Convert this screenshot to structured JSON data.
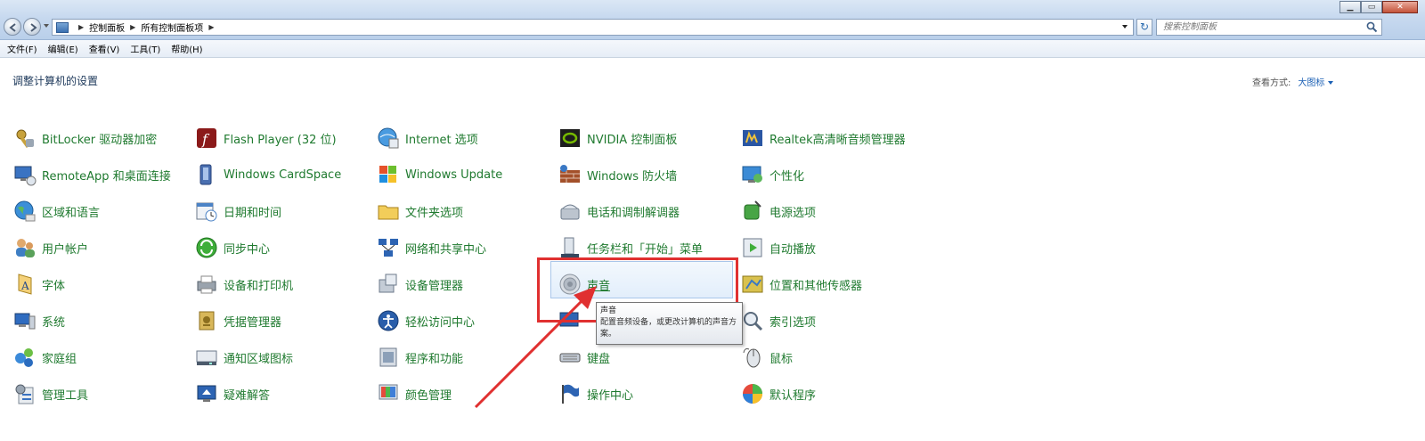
{
  "breadcrumb": [
    "控制面板",
    "所有控制面板项"
  ],
  "search": {
    "placeholder": "搜索控制面板"
  },
  "menu": [
    "文件(F)",
    "编辑(E)",
    "查看(V)",
    "工具(T)",
    "帮助(H)"
  ],
  "page_title": "调整计算机的设置",
  "view_by": {
    "label": "查看方式:",
    "value": "大图标"
  },
  "items": [
    "BitLocker 驱动器加密",
    "Flash Player (32 位)",
    "Internet 选项",
    "NVIDIA 控制面板",
    "Realtek高清晰音频管理器",
    "RemoteApp 和桌面连接",
    "Windows CardSpace",
    "Windows Update",
    "Windows 防火墙",
    "个性化",
    "区域和语言",
    "日期和时间",
    "文件夹选项",
    "电话和调制解调器",
    "电源选项",
    "用户帐户",
    "同步中心",
    "网络和共享中心",
    "任务栏和「开始」菜单",
    "自动播放",
    "字体",
    "设备和打印机",
    "设备管理器",
    "声音",
    "位置和其他传感器",
    "系统",
    "凭据管理器",
    "轻松访问中心",
    "",
    "索引选项",
    "家庭组",
    "通知区域图标",
    "程序和功能",
    "键盘",
    "鼠标",
    "管理工具",
    "疑难解答",
    "颜色管理",
    "操作中心",
    "默认程序"
  ],
  "tooltip": {
    "title": "声音",
    "text": "配置音频设备，或更改计算机的声音方案。"
  },
  "colors": {
    "link_green": "#1f7a2f",
    "highlight_box": "#e03030"
  }
}
